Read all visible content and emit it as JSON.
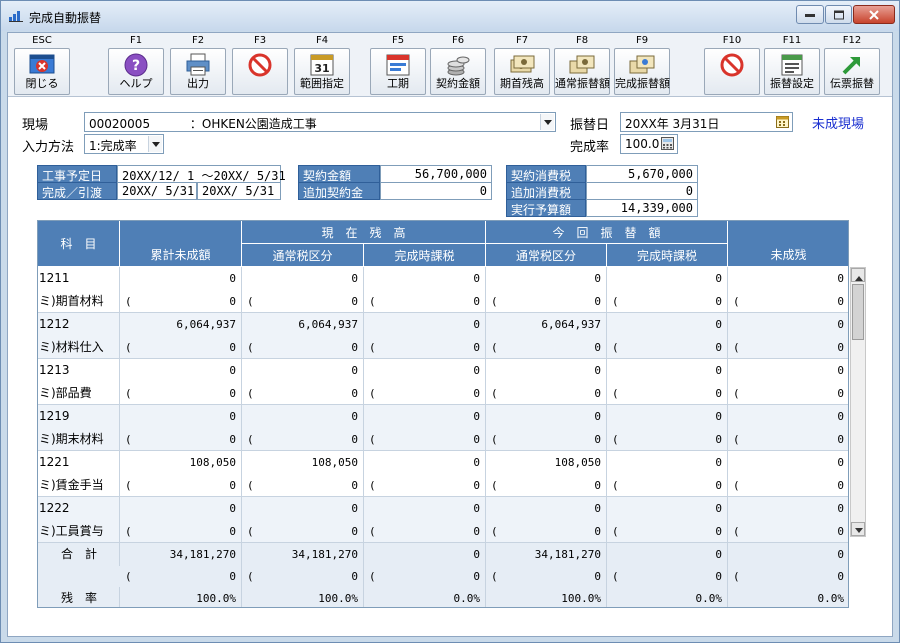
{
  "window": {
    "title": "完成自動振替"
  },
  "toolbar": [
    {
      "key": "ESC",
      "label": "閉じる",
      "icon": "close-window-icon"
    },
    {
      "key": "F1",
      "label": "ヘルプ",
      "icon": "help-icon"
    },
    {
      "key": "F2",
      "label": "出力",
      "icon": "print-icon"
    },
    {
      "key": "F3",
      "label": "",
      "icon": "disabled-icon"
    },
    {
      "key": "F4",
      "label": "範囲指定",
      "icon": "calendar-range-icon"
    },
    {
      "key": "F5",
      "label": "工期",
      "icon": "schedule-icon"
    },
    {
      "key": "F6",
      "label": "契約金額",
      "icon": "coins-icon"
    },
    {
      "key": "F7",
      "label": "期首残高",
      "icon": "opening-balance-icon"
    },
    {
      "key": "F8",
      "label": "通常振替額",
      "icon": "normal-transfer-icon"
    },
    {
      "key": "F9",
      "label": "完成振替額",
      "icon": "completion-transfer-icon"
    },
    {
      "key": "F10",
      "label": "",
      "icon": "disabled-icon"
    },
    {
      "key": "F11",
      "label": "振替設定",
      "icon": "transfer-settings-icon"
    },
    {
      "key": "F12",
      "label": "伝票振替",
      "icon": "voucher-transfer-icon"
    }
  ],
  "form": {
    "site_label": "現場",
    "site_code": "00020005",
    "site_name": "：OHKEN公園造成工事",
    "input_method_label": "入力方法",
    "input_method_value": "1:完成率",
    "transfer_date_label": "振替日",
    "transfer_date_value": "20XX年 3月31日",
    "completion_rate_label": "完成率",
    "completion_rate_value": "100.0",
    "status": "未成現場"
  },
  "summary": {
    "schedule_label": "工事予定日",
    "schedule_value": "20XX/12/ 1 ～20XX/ 5/31",
    "handover_label": "完成／引渡",
    "handover_value1": "20XX/ 5/31",
    "handover_value2": "20XX/ 5/31",
    "contract_amount_label": "契約金額",
    "contract_amount_value": "56,700,000",
    "additional_contract_label": "追加契約金",
    "additional_contract_value": "0",
    "contract_tax_label": "契約消費税",
    "contract_tax_value": "5,670,000",
    "additional_tax_label": "追加消費税",
    "additional_tax_value": "0",
    "budget_label": "実行予算額",
    "budget_value": "14,339,000"
  },
  "grid": {
    "headers": {
      "account": "科　目",
      "cumulative": "累計未成額",
      "current_balance": "現　在　残　高",
      "this_transfer": "今　回　振　替　額",
      "normal_tax": "通常税区分",
      "completion_tax": "完成時課税",
      "remaining": "未成残"
    },
    "rows": [
      {
        "code": "1211",
        "name": "ミ)期首材料",
        "cum": "0",
        "cur_n": "0",
        "cur_c": "0",
        "tr_n": "0",
        "tr_c": "0",
        "rem": "0"
      },
      {
        "code": "1212",
        "name": "ミ)材料仕入",
        "cum": "6,064,937",
        "cur_n": "6,064,937",
        "cur_c": "0",
        "tr_n": "6,064,937",
        "tr_c": "0",
        "rem": "0"
      },
      {
        "code": "1213",
        "name": "ミ)部品費",
        "cum": "0",
        "cur_n": "0",
        "cur_c": "0",
        "tr_n": "0",
        "tr_c": "0",
        "rem": "0"
      },
      {
        "code": "1219",
        "name": "ミ)期末材料",
        "cum": "0",
        "cur_n": "0",
        "cur_c": "0",
        "tr_n": "0",
        "tr_c": "0",
        "rem": "0"
      },
      {
        "code": "1221",
        "name": "ミ)賃金手当",
        "cum": "108,050",
        "cur_n": "108,050",
        "cur_c": "0",
        "tr_n": "108,050",
        "tr_c": "0",
        "rem": "0"
      },
      {
        "code": "1222",
        "name": "ミ)工員賞与",
        "cum": "0",
        "cur_n": "0",
        "cur_c": "0",
        "tr_n": "0",
        "tr_c": "0",
        "rem": "0"
      }
    ],
    "paren_value": "0",
    "paren_char": "(",
    "totals": {
      "label": "合　計",
      "cum": "34,181,270",
      "cur_n": "34,181,270",
      "cur_c": "0",
      "tr_n": "34,181,270",
      "tr_c": "0",
      "rem": "0",
      "rate_label": "残　率",
      "rate_cum": "100.0%",
      "rate_cur_n": "100.0%",
      "rate_cur_c": "0.0%",
      "rate_tr_n": "100.0%",
      "rate_tr_c": "0.0%",
      "rate_rem": "0.0%"
    }
  }
}
